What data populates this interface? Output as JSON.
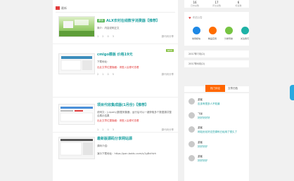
{
  "breadcrumb": {
    "label": "最新"
  },
  "posts": [
    {
      "tag": "原创",
      "title": "ALX农村在线数字消费器【推荐】",
      "excerpt": "简介：内容说明正文",
      "meta": [
        "1",
        "2",
        "0",
        "3"
      ],
      "category": "源代码分享"
    },
    {
      "title": "cmlgo模板 价格19元",
      "excerpt": "下载地址：",
      "excerpt_red": "出此文章位置隐藏：请登入后便可查看",
      "meta": [
        "2",
        "1",
        "0",
        "5"
      ],
      "category": "源代码分享",
      "badge": "NEW"
    },
    {
      "title": "项目代收集成器(1月份)【推荐】",
      "excerpt": "说明文：[.jquery]数据采集器，运行后可以一键获取多个数据源并整合展示结果",
      "excerpt_red": "出此文章位置隐藏：请登入后便可查看",
      "meta": [
        "1",
        "1",
        "0",
        "3"
      ],
      "category": "源代码分享"
    },
    {
      "title": "最新版源码分享网站源",
      "excerpt": "源码介绍：",
      "excerpt2": "演示下载地址：https://pan.baidu.com/s/1gBvfdvh",
      "meta": [
        "3",
        "2",
        "1",
        "4"
      ],
      "category": "源代码分享"
    }
  ],
  "stats": [
    {
      "value": "16",
      "label": "日志总数"
    },
    {
      "value": "17",
      "label": "评论总数"
    },
    {
      "value": "6",
      "label": "标签数"
    }
  ],
  "site": {
    "label": "本站公告"
  },
  "actions": [
    {
      "label": "常用模块",
      "color": "#1e88e5"
    },
    {
      "label": "精品应用",
      "color": "#ff6d00"
    },
    {
      "label": "分类导航",
      "color": "#76c442"
    },
    {
      "label": "关注我们",
      "color": "#1eb2a6"
    }
  ],
  "dates": [
    "2017年7月(2)",
    "2017年6月(2)"
  ],
  "tabs": {
    "active": "热门评论",
    "other": "文章归档"
  },
  "comments": [
    {
      "name": "游客",
      "text": "应该有很多人不知道"
    },
    {
      "name": "飞龙",
      "text": "好好好好好"
    },
    {
      "name": "游客",
      "text": "网站优化好这些源码已经用了很久了"
    },
    {
      "name": "游客",
      "text": "好好好好"
    },
    {
      "name": "游客",
      "text": "好好好好"
    }
  ]
}
